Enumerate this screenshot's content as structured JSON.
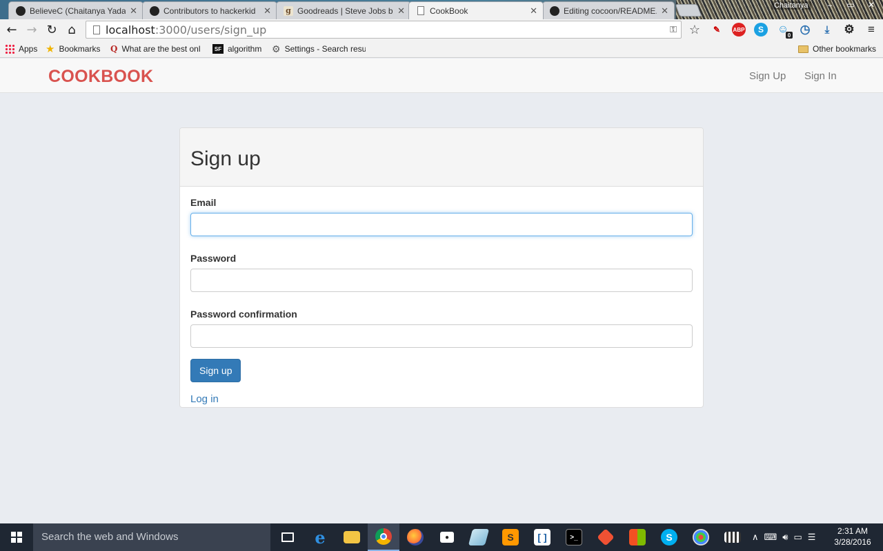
{
  "browser": {
    "tabs": [
      {
        "title": "BelieveC (Chaitanya Yadav",
        "icon": "github-icon",
        "active": false
      },
      {
        "title": "Contributors to hackerkid",
        "icon": "github-icon",
        "active": false
      },
      {
        "title": "Goodreads | Steve Jobs b",
        "icon": "goodreads-icon",
        "active": false
      },
      {
        "title": "CookBook",
        "icon": "page-icon",
        "active": true
      },
      {
        "title": "Editing cocoon/README.r",
        "icon": "github-icon",
        "active": false
      }
    ],
    "profile_name": "Chaitanya",
    "address": {
      "host": "localhost",
      "rest": ":3000/users/sign_up"
    },
    "bookmarks": [
      {
        "label": "Apps",
        "icon": "apps-grid-icon"
      },
      {
        "label": "Bookmarks",
        "icon": "star-icon"
      },
      {
        "label": "What are the best onl",
        "icon": "quora-icon"
      },
      {
        "label": "algorithm",
        "icon": "sf-icon"
      },
      {
        "label": "Settings - Search resu",
        "icon": "gear-icon"
      }
    ],
    "other_bookmarks": "Other bookmarks",
    "goodreads_glyph": "g",
    "abp_glyph": "ABP",
    "skype_glyph": "S",
    "badge_count": "0",
    "quora_glyph": "Q",
    "sf_glyph": "SF"
  },
  "app": {
    "brand": "COOKBOOK",
    "nav": {
      "sign_up": "Sign Up",
      "sign_in": "Sign In"
    },
    "brand_color": "#d9534f"
  },
  "form": {
    "title": "Sign up",
    "email_label": "Email",
    "email_value": "",
    "password_label": "Password",
    "password_value": "",
    "confirm_label": "Password confirmation",
    "confirm_value": "",
    "submit_label": "Sign up",
    "login_link": "Log in",
    "primary_color": "#337ab7"
  },
  "taskbar": {
    "search_placeholder": "Search the web and Windows",
    "apps": [
      "task-view-icon",
      "edge-icon",
      "file-explorer-icon",
      "chrome-icon",
      "firefox-icon",
      "camera-icon",
      "notepad-icon",
      "sublime-icon",
      "brackets-icon",
      "cmd-icon",
      "git-icon",
      "windows-store-icon",
      "skype-icon",
      "paint-icon",
      "movie-maker-icon"
    ],
    "time": "2:31 AM",
    "date": "3/28/2016"
  }
}
